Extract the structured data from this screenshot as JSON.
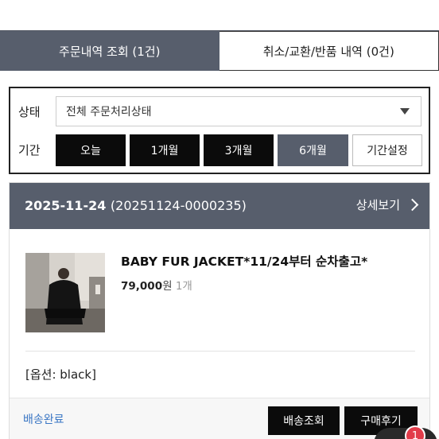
{
  "tabs": [
    {
      "label": "주문내역 조회 (1건)",
      "active": true
    },
    {
      "label": "취소/교환/반품 내역 (0건)",
      "active": false
    }
  ],
  "filter": {
    "status_label": "상태",
    "status_value": "전체 주문처리상태",
    "period_label": "기간",
    "periods": [
      "오늘",
      "1개월",
      "3개월",
      "6개월"
    ],
    "selected_period": "6개월",
    "custom_period_label": "기간설정"
  },
  "order": {
    "date": "2025-11-24",
    "order_number": "(20251124-0000235)",
    "detail_label": "상세보기",
    "product": {
      "name": "BABY FUR JACKET*11/24부터 순차출고*",
      "price": "79,000",
      "price_unit": "원",
      "quantity": "1개"
    },
    "option": "[옵션: black]",
    "shipping_status": "배송완료",
    "track_button": "배송조회",
    "review_button": "구매후기"
  },
  "chat": {
    "badge_count": "1"
  },
  "colors": {
    "accent": "#575e6c",
    "link": "#3a76c4",
    "badge": "#e23c4a"
  }
}
